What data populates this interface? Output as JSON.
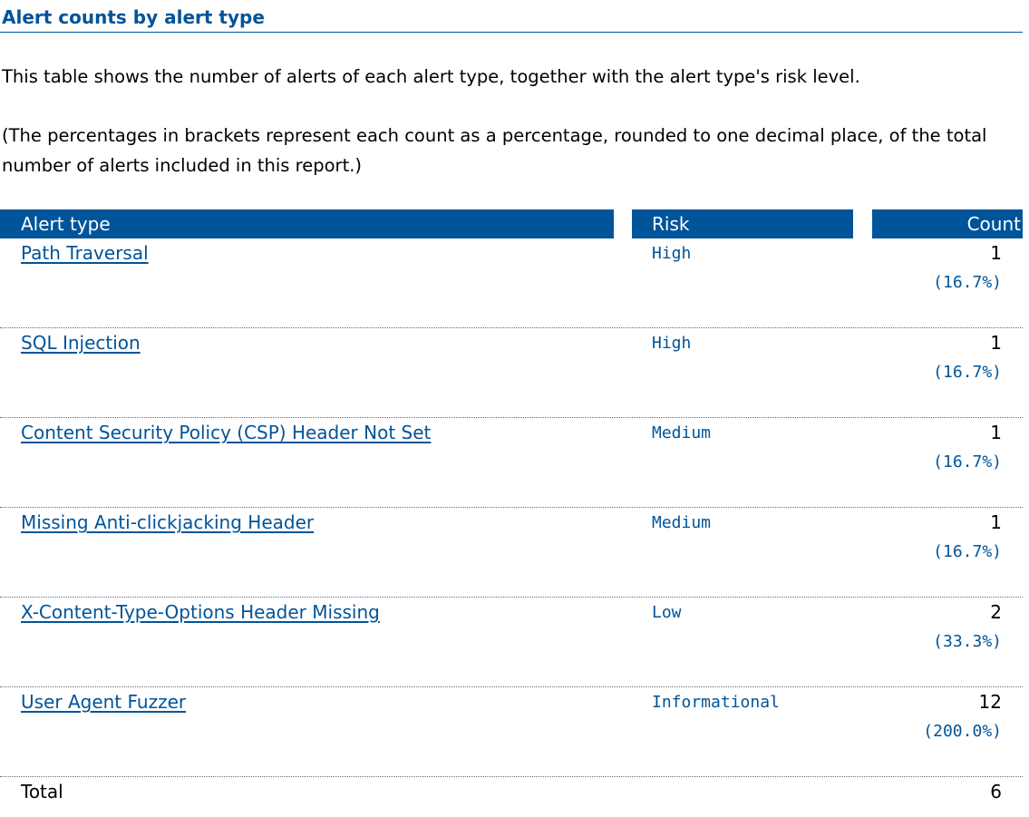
{
  "section": {
    "title": "Alert counts by alert type",
    "description": "This table shows the number of alerts of each alert type, together with the alert type's risk level.",
    "note": "(The percentages in brackets represent each count as a percentage, rounded to one decimal place, of the total number of alerts included in this report.)"
  },
  "table": {
    "headers": {
      "alert_type": "Alert type",
      "risk": "Risk",
      "count": "Count"
    },
    "rows": [
      {
        "alert_type": "Path Traversal",
        "risk": "High",
        "count": "1",
        "percentage": "(16.7%)"
      },
      {
        "alert_type": "SQL Injection",
        "risk": "High",
        "count": "1",
        "percentage": "(16.7%)"
      },
      {
        "alert_type": "Content Security Policy (CSP) Header Not Set",
        "risk": "Medium",
        "count": "1",
        "percentage": "(16.7%)"
      },
      {
        "alert_type": "Missing Anti-clickjacking Header",
        "risk": "Medium",
        "count": "1",
        "percentage": "(16.7%)"
      },
      {
        "alert_type": "X-Content-Type-Options Header Missing",
        "risk": "Low",
        "count": "2",
        "percentage": "(33.3%)"
      },
      {
        "alert_type": "User Agent Fuzzer",
        "risk": "Informational",
        "count": "12",
        "percentage": "(200.0%)"
      }
    ],
    "total": {
      "label": "Total",
      "value": "6"
    }
  },
  "colors": {
    "accent": "#005499",
    "header_text": "#ffffff",
    "body_text": "#000000"
  }
}
